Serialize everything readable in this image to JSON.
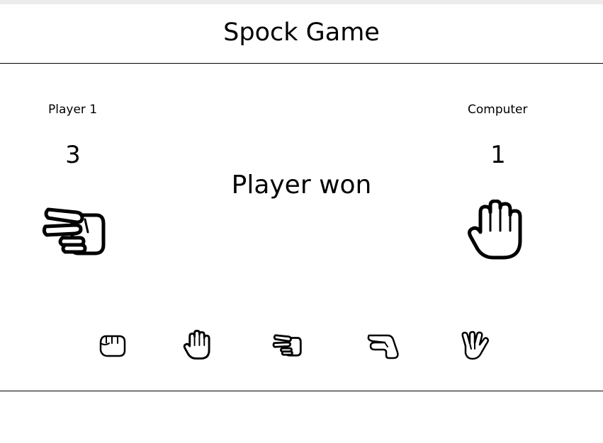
{
  "header": {
    "title": "Spock Game"
  },
  "player": {
    "label": "Player 1",
    "score": "3",
    "hand_icon": "scissors-hand-icon"
  },
  "computer": {
    "label": "Computer",
    "score": "1",
    "hand_icon": "paper-hand-icon"
  },
  "result": "Player won",
  "choices": [
    {
      "name": "rock",
      "icon": "rock-hand-icon"
    },
    {
      "name": "paper",
      "icon": "paper-hand-icon"
    },
    {
      "name": "scissors",
      "icon": "scissors-hand-icon"
    },
    {
      "name": "lizard",
      "icon": "lizard-hand-icon"
    },
    {
      "name": "spock",
      "icon": "spock-hand-icon"
    }
  ],
  "colors": {
    "background": "#ffffff",
    "ink": "#000000",
    "top_strip": "#ececec"
  }
}
